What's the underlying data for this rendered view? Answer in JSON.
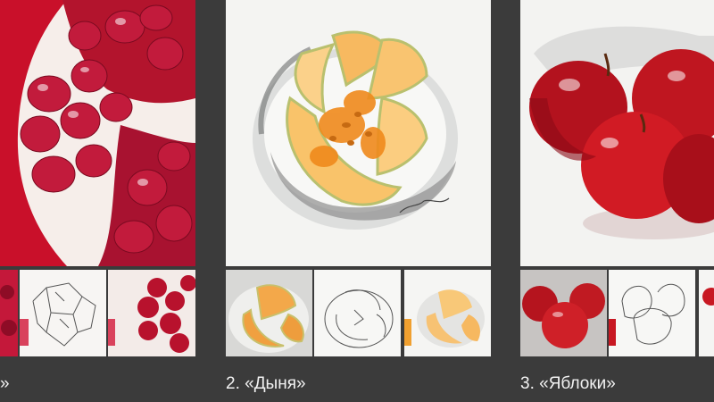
{
  "panels": [
    {
      "caption": "»"
    },
    {
      "caption": "2. «Дыня»"
    },
    {
      "caption": "3. «Яблоки»"
    }
  ],
  "colors": {
    "background": "#3b3b3b",
    "caption_text": "#f2f2f2",
    "pomegranate_red": "#b8122d",
    "melon_orange": "#f3a13b",
    "apple_red": "#c81822"
  }
}
